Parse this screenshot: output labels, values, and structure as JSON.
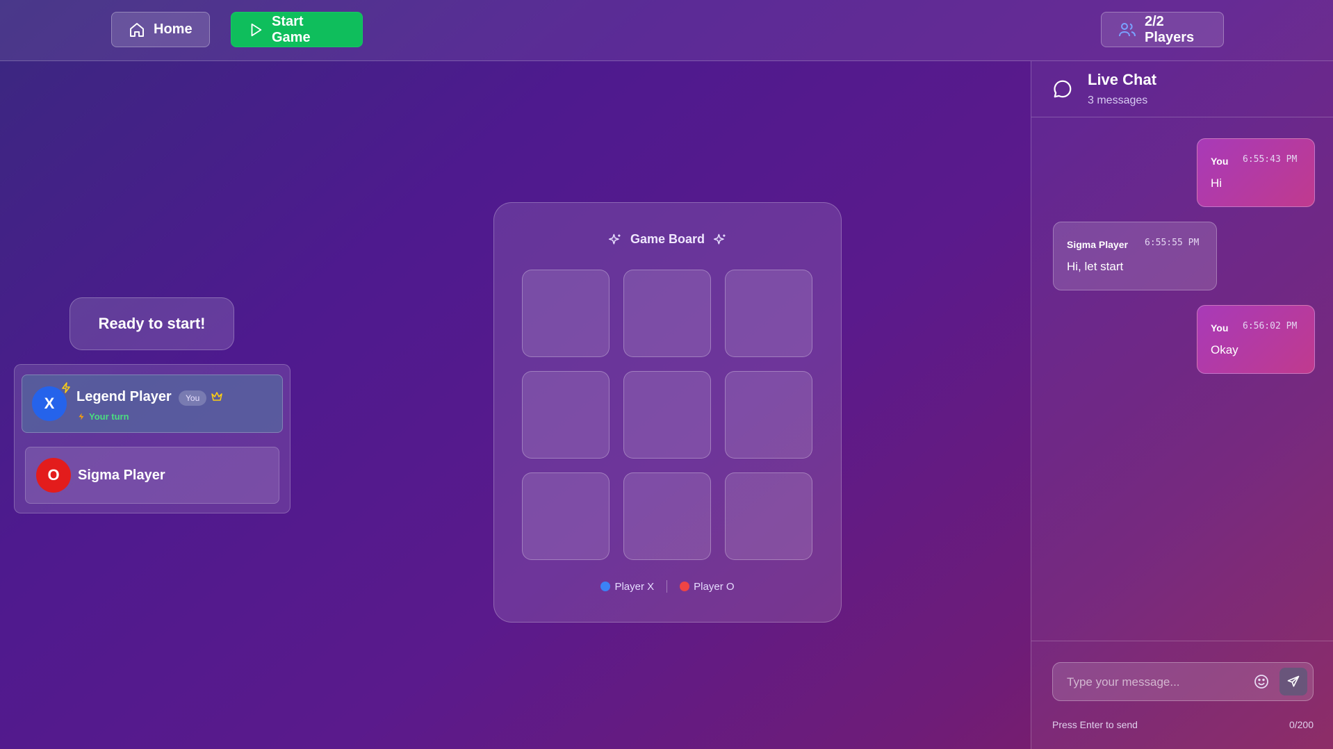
{
  "topbar": {
    "home_label": "Home",
    "start_label": "Start Game",
    "players_label": "2/2 Players"
  },
  "status": {
    "ready_text": "Ready to start!"
  },
  "players": [
    {
      "symbol": "X",
      "name": "Legend Player",
      "badge": "You",
      "turn_text": "Your turn",
      "color": "#2563eb"
    },
    {
      "symbol": "O",
      "name": "Sigma Player",
      "color": "#e31c1c"
    }
  ],
  "board": {
    "title": "Game Board",
    "cells": [
      "",
      "",
      "",
      "",
      "",
      "",
      "",
      "",
      ""
    ],
    "legend_x": "Player X",
    "legend_o": "Player O",
    "legend_x_color": "#3b82f6",
    "legend_o_color": "#ef4444"
  },
  "chat": {
    "title": "Live Chat",
    "count_text": "3 messages",
    "messages": [
      {
        "sender": "You",
        "time": "6:55:43 PM",
        "text": "Hi"
      },
      {
        "sender": "Sigma Player",
        "time": "6:55:55 PM",
        "text": "Hi, let start"
      },
      {
        "sender": "You",
        "time": "6:56:02 PM",
        "text": "Okay"
      }
    ],
    "input_value": "",
    "input_placeholder": "Type your message...",
    "hint": "Press Enter to send",
    "counter": "0/200"
  }
}
